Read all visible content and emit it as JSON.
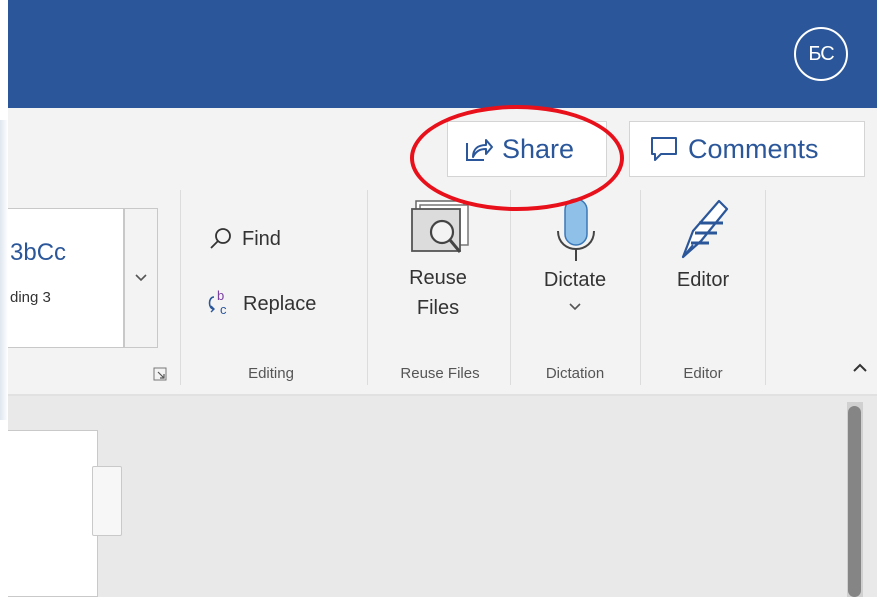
{
  "titlebar": {
    "avatar_initials": "БС",
    "bg_color": "#2b579a"
  },
  "header_actions": {
    "share_label": "Share",
    "comments_label": "Comments"
  },
  "ribbon": {
    "styles": {
      "sample_text": "3bCc",
      "style_name": "ding 3"
    },
    "editing": {
      "find_label": "Find",
      "replace_label": "Replace",
      "group_label": "Editing"
    },
    "reuse_files": {
      "button_line1": "Reuse",
      "button_line2": "Files",
      "group_label": "Reuse Files"
    },
    "dictation": {
      "button_label": "Dictate",
      "group_label": "Dictation"
    },
    "editor": {
      "button_label": "Editor",
      "group_label": "Editor"
    }
  },
  "accent_color": "#2b579a",
  "highlight_color": "#e8101a",
  "icons": [
    "share-icon",
    "comment-icon",
    "search-icon",
    "replace-icon",
    "reuse-files-icon",
    "microphone-icon",
    "editor-pen-icon",
    "chevron-down-icon",
    "chevron-up-icon",
    "dialog-launcher-icon"
  ]
}
